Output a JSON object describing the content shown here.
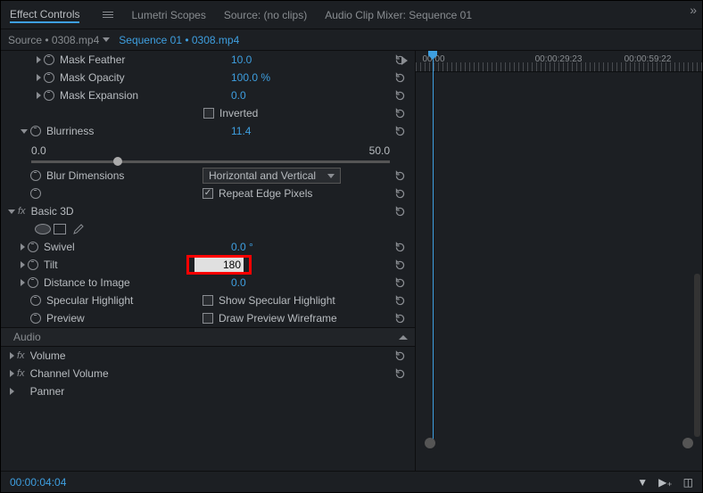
{
  "tabs": {
    "effectControls": "Effect Controls",
    "lumetri": "Lumetri Scopes",
    "source": "Source: (no clips)",
    "audioMixer": "Audio Clip Mixer: Sequence 01"
  },
  "source": {
    "clip": "Source • 0308.mp4",
    "sequence": "Sequence 01 • 0308.mp4"
  },
  "props": {
    "maskFeather": {
      "label": "Mask Feather",
      "value": "10.0"
    },
    "maskOpacity": {
      "label": "Mask Opacity",
      "value": "100.0 %"
    },
    "maskExpansion": {
      "label": "Mask Expansion",
      "value": "0.0"
    },
    "inverted": {
      "label": "Inverted",
      "checked": false
    },
    "blurriness": {
      "label": "Blurriness",
      "value": "11.4",
      "min": "0.0",
      "max": "50.0"
    },
    "blurDimensions": {
      "label": "Blur Dimensions",
      "value": "Horizontal and Vertical"
    },
    "repeatEdge": {
      "label": "Repeat Edge Pixels",
      "checked": true
    },
    "basic3d": {
      "label": "Basic 3D"
    },
    "swivel": {
      "label": "Swivel",
      "value": "0.0 °"
    },
    "tilt": {
      "label": "Tilt",
      "value": "180"
    },
    "distance": {
      "label": "Distance to Image",
      "value": "0.0"
    },
    "specular": {
      "label": "Specular Highlight",
      "check": "Show Specular Highlight"
    },
    "preview": {
      "label": "Preview",
      "check": "Draw Preview Wireframe"
    }
  },
  "audio": {
    "header": "Audio",
    "volume": "Volume",
    "channelVolume": "Channel Volume",
    "panner": "Panner"
  },
  "timeline": {
    "ticks": [
      "00:00",
      "00:00:29:23",
      "00:00:59:22"
    ]
  },
  "footer": {
    "timecode": "00:00:04:04"
  }
}
